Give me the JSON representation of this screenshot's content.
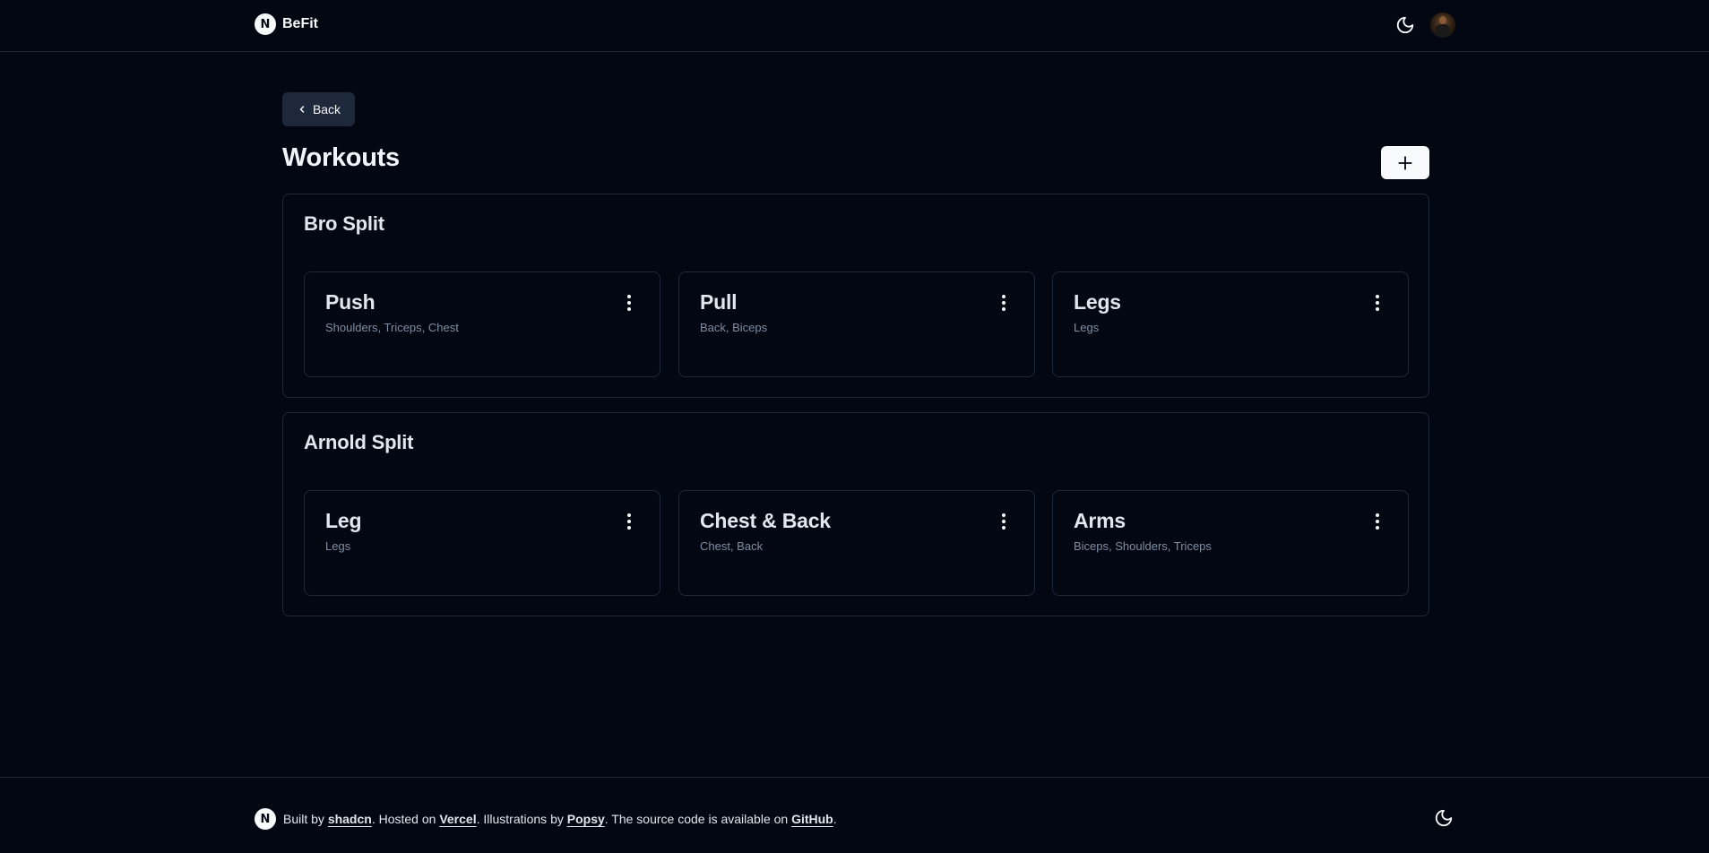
{
  "header": {
    "logo_letter": "N",
    "brand": "BeFit",
    "theme_icon": "moon-icon",
    "avatar": "user-avatar"
  },
  "main": {
    "back_label": "Back",
    "title": "Workouts",
    "add_icon": "plus-icon",
    "splits": [
      {
        "name": "Bro Split",
        "workouts": [
          {
            "name": "Push",
            "muscles": "Shoulders, Triceps, Chest"
          },
          {
            "name": "Pull",
            "muscles": "Back, Biceps"
          },
          {
            "name": "Legs",
            "muscles": "Legs"
          }
        ]
      },
      {
        "name": "Arnold Split",
        "workouts": [
          {
            "name": "Leg",
            "muscles": "Legs"
          },
          {
            "name": "Chest & Back",
            "muscles": "Chest, Back"
          },
          {
            "name": "Arms",
            "muscles": "Biceps, Shoulders, Triceps"
          }
        ]
      }
    ]
  },
  "footer": {
    "logo_letter": "N",
    "built_by": "Built by ",
    "built_by_link": "shadcn",
    "hosted_on": ". Hosted on ",
    "hosted_on_link": "Vercel",
    "illustrations_by": ". Illustrations by ",
    "illustrations_link": "Popsy",
    "source_text": ". The source code is available on ",
    "source_link": "GitHub",
    "end": "."
  },
  "colors": {
    "background": "#030711",
    "border": "#1d283a",
    "text": "#e1e7ef",
    "muted": "#7f8ea3",
    "button_light": "#f8fafc"
  }
}
